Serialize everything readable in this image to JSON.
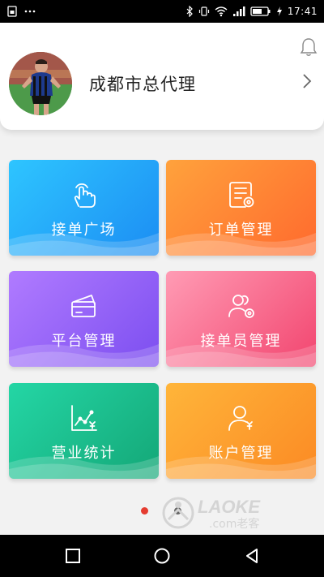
{
  "status_bar": {
    "time": "17:41",
    "left_icons": [
      "sim-icon",
      "more-dots-icon"
    ],
    "right_icons": [
      "bluetooth-icon",
      "vibrate-icon",
      "wifi-icon",
      "signal-icon",
      "battery-icon",
      "charging-icon"
    ]
  },
  "profile": {
    "name": "成都市总代理",
    "avatar": "avatar-photo",
    "icons": [
      "bell-icon",
      "chevron-right-icon"
    ]
  },
  "tiles": [
    {
      "label": "接单广场",
      "icon": "hand-pointer-icon",
      "from": "#2ec5ff",
      "to": "#1c8df3"
    },
    {
      "label": "订单管理",
      "icon": "order-settings-icon",
      "from": "#ffa23c",
      "to": "#ff6a2e"
    },
    {
      "label": "平台管理",
      "icon": "cards-icon",
      "from": "#b07bff",
      "to": "#7c4ef0"
    },
    {
      "label": "接单员管理",
      "icon": "users-settings-icon",
      "from": "#ff9bb4",
      "to": "#f2456f"
    },
    {
      "label": "营业统计",
      "icon": "chart-yen-icon",
      "from": "#24d6a5",
      "to": "#14a777"
    },
    {
      "label": "账户管理",
      "icon": "user-yen-icon",
      "from": "#ffb53a",
      "to": "#fb8a24"
    }
  ],
  "pager": {
    "active": 1,
    "total": 2,
    "active_color": "#e53c30",
    "inactive_color": "#666666"
  },
  "watermark": {
    "text": "LAOKE",
    "subtext": ".com老客"
  },
  "nav": [
    "square-icon",
    "circle-icon",
    "back-triangle-icon"
  ]
}
